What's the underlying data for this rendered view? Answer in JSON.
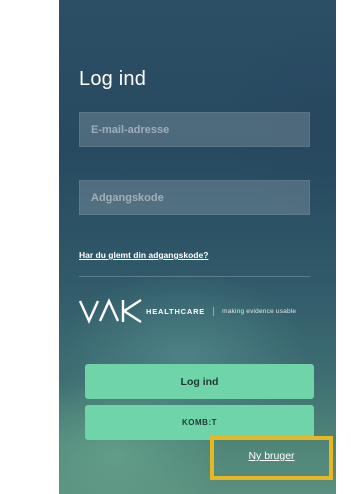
{
  "login": {
    "title": "Log ind",
    "email_placeholder": "E-mail-adresse",
    "password_placeholder": "Adgangskode",
    "forgot_link": "Har du glemt din adgangskode?"
  },
  "brand": {
    "logo_icon": "vak-logo-icon",
    "name": "HEALTHCARE",
    "tagline": "making evidence usable"
  },
  "buttons": {
    "login_label": "Log ind",
    "kombit_label": "KOMB:T"
  },
  "new_user": {
    "label": "Ny bruger",
    "highlight_color": "#e8b822"
  },
  "colors": {
    "button_bg": "#6fd5a8",
    "background_top": "#2c4f66",
    "background_bottom": "#5a8f7e"
  }
}
